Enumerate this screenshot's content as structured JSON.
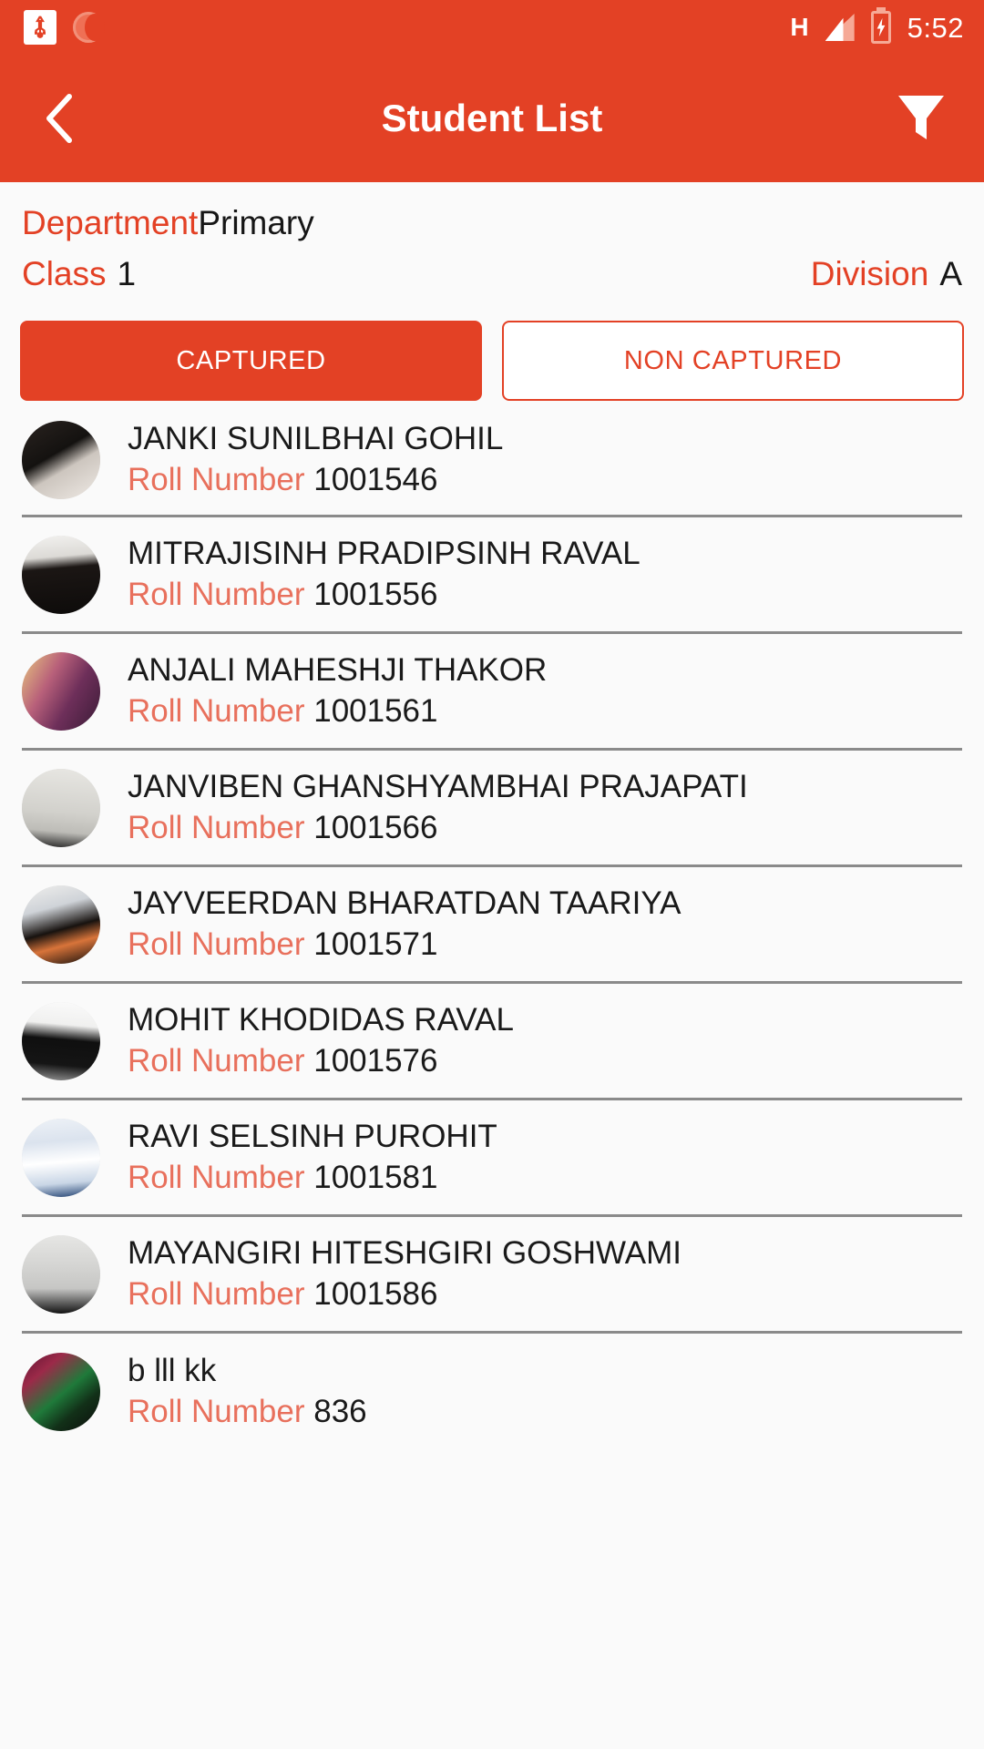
{
  "colors": {
    "primary": "#E34125",
    "roll_label": "#E8705C",
    "background": "#fafafa",
    "divider": "#8a8a8a"
  },
  "status_bar": {
    "usb_icon": "usb-icon",
    "sync_icon": "sync-icon",
    "network_type": "H",
    "signal_icon": "signal-icon",
    "battery_icon": "battery-charging-icon",
    "time": "5:52"
  },
  "app_bar": {
    "back_icon": "back-chevron-icon",
    "title": "Student List",
    "filter_icon": "filter-funnel-icon"
  },
  "filters": {
    "department_label": "Department",
    "department_value": "Primary",
    "class_label": "Class",
    "class_value": "1",
    "division_label": "Division",
    "division_value": "A"
  },
  "tabs": [
    {
      "label": "CAPTURED",
      "active": true
    },
    {
      "label": "NON CAPTURED",
      "active": false
    }
  ],
  "list": {
    "roll_label": "Roll Number",
    "students": [
      {
        "name": "JANKI SUNILBHAI GOHIL",
        "roll": "1001546"
      },
      {
        "name": "MITRAJISINH PRADIPSINH RAVAL",
        "roll": "1001556"
      },
      {
        "name": "ANJALI MAHESHJI THAKOR",
        "roll": "1001561"
      },
      {
        "name": "JANVIBEN GHANSHYAMBHAI PRAJAPATI",
        "roll": "1001566"
      },
      {
        "name": "JAYVEERDAN BHARATDAN TAARIYA",
        "roll": "1001571"
      },
      {
        "name": "MOHIT KHODIDAS RAVAL",
        "roll": "1001576"
      },
      {
        "name": "RAVI SELSINH PUROHIT",
        "roll": "1001581"
      },
      {
        "name": "MAYANGIRI HITESHGIRI GOSHWAMI",
        "roll": "1001586"
      },
      {
        "name": "b lll kk",
        "roll": "836"
      }
    ]
  }
}
